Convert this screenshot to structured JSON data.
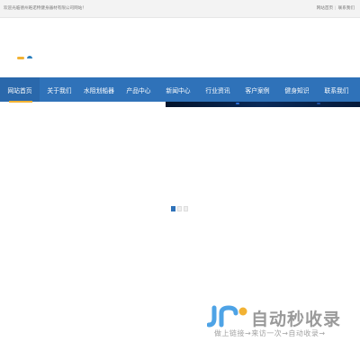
{
  "topbar": {
    "welcome": "欢迎光临德州皓诺特健身器材有限公司网站！",
    "links": [
      "网站首页",
      "联系我们"
    ]
  },
  "nav": {
    "items": [
      {
        "label": "网站首页"
      },
      {
        "label": "关于我们"
      },
      {
        "label": "水阻划船器"
      },
      {
        "label": "产品中心"
      },
      {
        "label": "新闻中心"
      },
      {
        "label": "行业资讯"
      },
      {
        "label": "客户案例"
      },
      {
        "label": "健身知识"
      },
      {
        "label": "联系我们"
      }
    ],
    "active_index": 0
  },
  "slider": {
    "dot_count": 3,
    "active_index": 0
  },
  "watermark": {
    "title": "自动秒收录",
    "subtitle": "做上链接→来访一次→自动收录→",
    "icon": "jr-logo-icon"
  },
  "colors": {
    "nav_bg": "#2f72b9",
    "accent_orange": "#f2b233",
    "watermark_blue": "#4ea3e6",
    "watermark_yellow": "#f2b233"
  }
}
